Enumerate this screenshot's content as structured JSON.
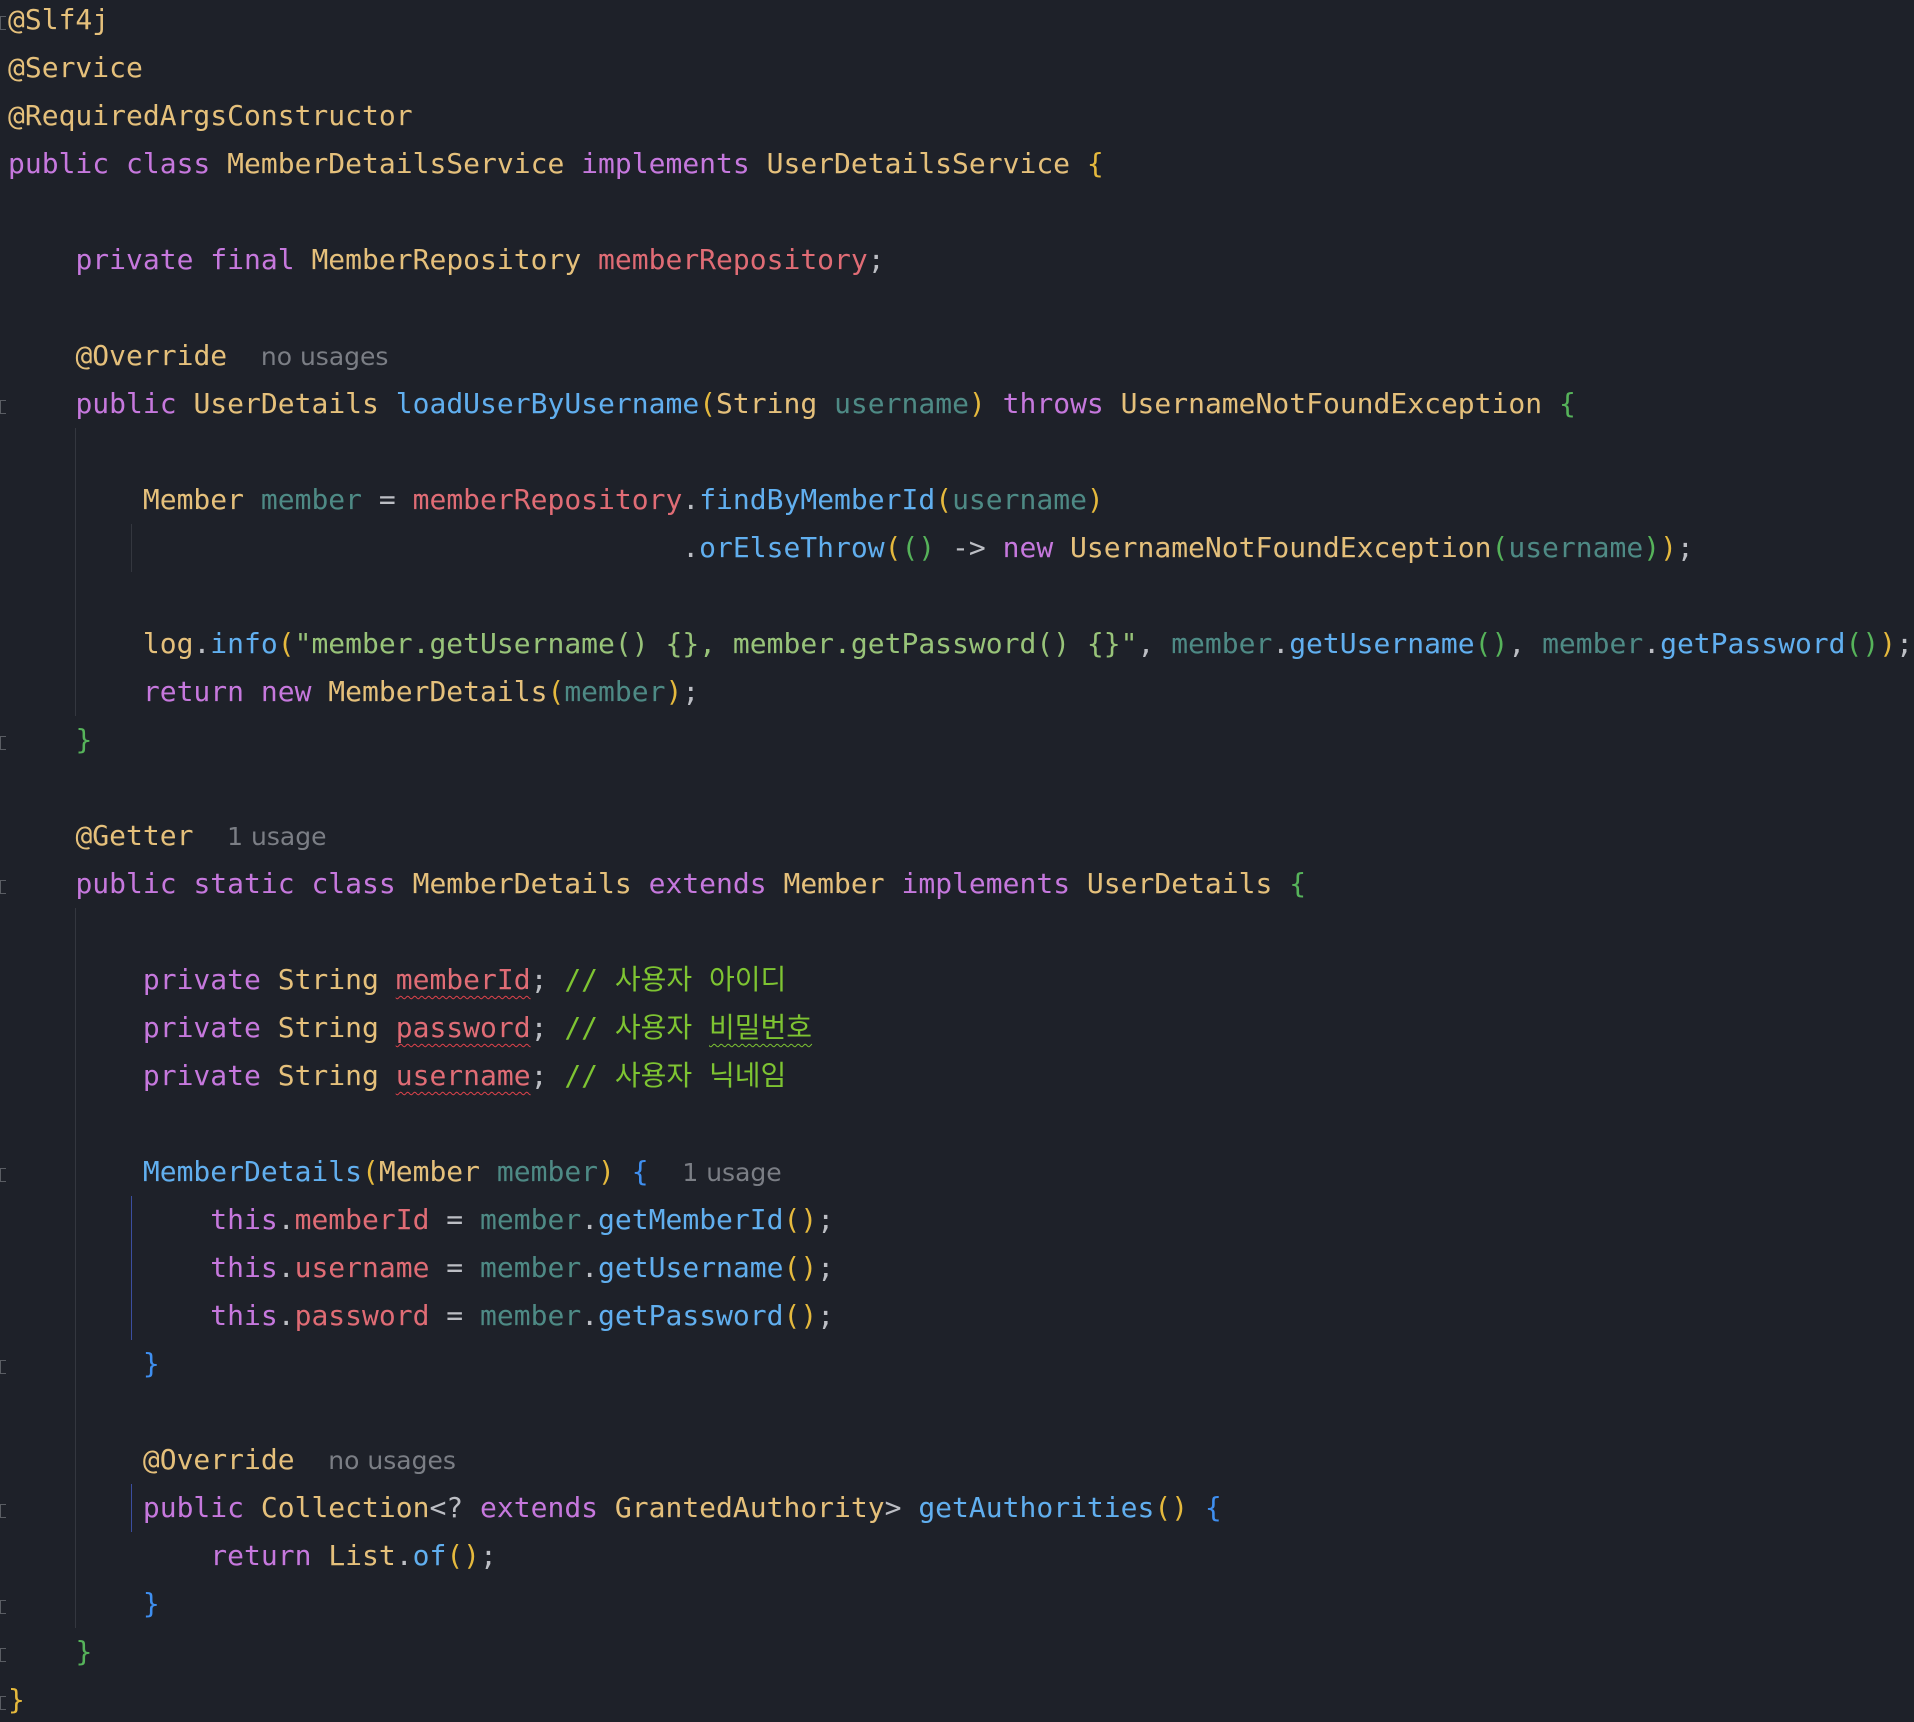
{
  "theme": {
    "background": "#1e2129",
    "keyword": "#c678dd",
    "type": "#e5c07b",
    "method": "#61afef",
    "field": "#e06c75",
    "param": "#4e8a85",
    "string": "#98c379",
    "comment": "#7ec432",
    "brace1": "#e5b93d",
    "brace2": "#56b35a",
    "brace3": "#3f8ff0",
    "plain": "#bcbec4",
    "hint": "#7b7e85",
    "guide": "#34373f",
    "guide_active": "#3b4ea0"
  },
  "lines": [
    [
      {
        "t": "@Slf4j",
        "c": "type"
      }
    ],
    [
      {
        "t": "@Service",
        "c": "type"
      }
    ],
    [
      {
        "t": "@RequiredArgsConstructor",
        "c": "type"
      }
    ],
    [
      {
        "t": "public class ",
        "c": "keyword"
      },
      {
        "t": "MemberDetailsService ",
        "c": "type"
      },
      {
        "t": "implements ",
        "c": "keyword"
      },
      {
        "t": "UserDetailsService ",
        "c": "type"
      },
      {
        "t": "{",
        "c": "brace1"
      }
    ],
    [],
    [
      {
        "t": "    "
      },
      {
        "t": "private final ",
        "c": "keyword"
      },
      {
        "t": "MemberRepository ",
        "c": "type"
      },
      {
        "t": "memberRepository",
        "c": "field"
      },
      {
        "t": ";",
        "c": "plain"
      }
    ],
    [],
    [
      {
        "t": "    "
      },
      {
        "t": "@Override",
        "c": "type"
      },
      {
        "t": "  "
      },
      {
        "t": "no usages",
        "c": "hint",
        "h": 1
      }
    ],
    [
      {
        "t": "    "
      },
      {
        "t": "public ",
        "c": "keyword"
      },
      {
        "t": "UserDetails ",
        "c": "type"
      },
      {
        "t": "loadUserByUsername",
        "c": "method"
      },
      {
        "t": "(",
        "c": "brace1"
      },
      {
        "t": "String ",
        "c": "type"
      },
      {
        "t": "username",
        "c": "param"
      },
      {
        "t": ") ",
        "c": "brace1"
      },
      {
        "t": "throws ",
        "c": "keyword"
      },
      {
        "t": "UsernameNotFoundException ",
        "c": "type"
      },
      {
        "t": "{",
        "c": "brace2"
      }
    ],
    [],
    [
      {
        "t": "        "
      },
      {
        "t": "Member ",
        "c": "type"
      },
      {
        "t": "member",
        "c": "param"
      },
      {
        "t": " = ",
        "c": "plain"
      },
      {
        "t": "memberRepository",
        "c": "field"
      },
      {
        "t": ".",
        "c": "plain"
      },
      {
        "t": "findByMemberId",
        "c": "method"
      },
      {
        "t": "(",
        "c": "brace1"
      },
      {
        "t": "username",
        "c": "param"
      },
      {
        "t": ")",
        "c": "brace1"
      }
    ],
    [
      {
        "t": "                                        "
      },
      {
        "t": ".",
        "c": "plain"
      },
      {
        "t": "orElseThrow",
        "c": "method"
      },
      {
        "t": "(",
        "c": "brace1"
      },
      {
        "t": "()",
        "c": "brace2"
      },
      {
        "t": " -> ",
        "c": "plain"
      },
      {
        "t": "new ",
        "c": "keyword"
      },
      {
        "t": "UsernameNotFoundException",
        "c": "type"
      },
      {
        "t": "(",
        "c": "brace2"
      },
      {
        "t": "username",
        "c": "param"
      },
      {
        "t": ")",
        "c": "brace2"
      },
      {
        "t": ")",
        "c": "brace1"
      },
      {
        "t": ";",
        "c": "plain"
      }
    ],
    [],
    [
      {
        "t": "        "
      },
      {
        "t": "log",
        "c": "type"
      },
      {
        "t": ".",
        "c": "plain"
      },
      {
        "t": "info",
        "c": "method"
      },
      {
        "t": "(",
        "c": "brace1"
      },
      {
        "t": "\"member.getUsername() {}, member.getPassword() {}\"",
        "c": "string"
      },
      {
        "t": ", ",
        "c": "plain"
      },
      {
        "t": "member",
        "c": "param"
      },
      {
        "t": ".",
        "c": "plain"
      },
      {
        "t": "getUsername",
        "c": "method"
      },
      {
        "t": "()",
        "c": "brace2"
      },
      {
        "t": ", ",
        "c": "plain"
      },
      {
        "t": "member",
        "c": "param"
      },
      {
        "t": ".",
        "c": "plain"
      },
      {
        "t": "getPassword",
        "c": "method"
      },
      {
        "t": "()",
        "c": "brace2"
      },
      {
        "t": ")",
        "c": "brace1"
      },
      {
        "t": ";",
        "c": "plain"
      }
    ],
    [
      {
        "t": "        "
      },
      {
        "t": "return new ",
        "c": "keyword"
      },
      {
        "t": "MemberDetails",
        "c": "type"
      },
      {
        "t": "(",
        "c": "brace1"
      },
      {
        "t": "member",
        "c": "param"
      },
      {
        "t": ")",
        "c": "brace1"
      },
      {
        "t": ";",
        "c": "plain"
      }
    ],
    [
      {
        "t": "    "
      },
      {
        "t": "}",
        "c": "brace2"
      }
    ],
    [],
    [
      {
        "t": "    "
      },
      {
        "t": "@Getter",
        "c": "type"
      },
      {
        "t": "  "
      },
      {
        "t": "1 usage",
        "c": "hint",
        "h": 1
      }
    ],
    [
      {
        "t": "    "
      },
      {
        "t": "public static class ",
        "c": "keyword"
      },
      {
        "t": "MemberDetails ",
        "c": "type"
      },
      {
        "t": "extends ",
        "c": "keyword"
      },
      {
        "t": "Member ",
        "c": "type"
      },
      {
        "t": "implements ",
        "c": "keyword"
      },
      {
        "t": "UserDetails ",
        "c": "type"
      },
      {
        "t": "{",
        "c": "brace2"
      }
    ],
    [],
    [
      {
        "t": "        "
      },
      {
        "t": "private ",
        "c": "keyword"
      },
      {
        "t": "String ",
        "c": "type"
      },
      {
        "t": "memberId",
        "c": "field",
        "sq": 1
      },
      {
        "t": "; ",
        "c": "plain"
      },
      {
        "t": "// 사용자 아이디",
        "c": "comment"
      }
    ],
    [
      {
        "t": "        "
      },
      {
        "t": "private ",
        "c": "keyword"
      },
      {
        "t": "String ",
        "c": "type"
      },
      {
        "t": "password",
        "c": "field",
        "sq": 1
      },
      {
        "t": "; ",
        "c": "plain"
      },
      {
        "t": "// 사용자 ",
        "c": "comment"
      },
      {
        "t": "비밀번호",
        "c": "comment",
        "sq": 1
      }
    ],
    [
      {
        "t": "        "
      },
      {
        "t": "private ",
        "c": "keyword"
      },
      {
        "t": "String ",
        "c": "type"
      },
      {
        "t": "username",
        "c": "field",
        "sq": 1
      },
      {
        "t": "; ",
        "c": "plain"
      },
      {
        "t": "// 사용자 닉네임",
        "c": "comment"
      }
    ],
    [],
    [
      {
        "t": "        "
      },
      {
        "t": "MemberDetails",
        "c": "method"
      },
      {
        "t": "(",
        "c": "brace1"
      },
      {
        "t": "Member ",
        "c": "type"
      },
      {
        "t": "member",
        "c": "param"
      },
      {
        "t": ") ",
        "c": "brace1"
      },
      {
        "t": "{",
        "c": "brace3"
      },
      {
        "t": "  "
      },
      {
        "t": "1 usage",
        "c": "hint",
        "h": 1
      }
    ],
    [
      {
        "t": "            "
      },
      {
        "t": "this",
        "c": "keyword"
      },
      {
        "t": ".",
        "c": "plain"
      },
      {
        "t": "memberId",
        "c": "field"
      },
      {
        "t": " = ",
        "c": "plain"
      },
      {
        "t": "member",
        "c": "param"
      },
      {
        "t": ".",
        "c": "plain"
      },
      {
        "t": "getMemberId",
        "c": "method"
      },
      {
        "t": "()",
        "c": "brace1"
      },
      {
        "t": ";",
        "c": "plain"
      }
    ],
    [
      {
        "t": "            "
      },
      {
        "t": "this",
        "c": "keyword"
      },
      {
        "t": ".",
        "c": "plain"
      },
      {
        "t": "username",
        "c": "field"
      },
      {
        "t": " = ",
        "c": "plain"
      },
      {
        "t": "member",
        "c": "param"
      },
      {
        "t": ".",
        "c": "plain"
      },
      {
        "t": "getUsername",
        "c": "method"
      },
      {
        "t": "()",
        "c": "brace1"
      },
      {
        "t": ";",
        "c": "plain"
      }
    ],
    [
      {
        "t": "            "
      },
      {
        "t": "this",
        "c": "keyword"
      },
      {
        "t": ".",
        "c": "plain"
      },
      {
        "t": "password",
        "c": "field"
      },
      {
        "t": " = ",
        "c": "plain"
      },
      {
        "t": "member",
        "c": "param"
      },
      {
        "t": ".",
        "c": "plain"
      },
      {
        "t": "getPassword",
        "c": "method"
      },
      {
        "t": "()",
        "c": "brace1"
      },
      {
        "t": ";",
        "c": "plain"
      }
    ],
    [
      {
        "t": "        "
      },
      {
        "t": "}",
        "c": "brace3"
      }
    ],
    [],
    [
      {
        "t": "        "
      },
      {
        "t": "@Override",
        "c": "type"
      },
      {
        "t": "  "
      },
      {
        "t": "no usages",
        "c": "hint",
        "h": 1
      }
    ],
    [
      {
        "t": "        "
      },
      {
        "t": "public ",
        "c": "keyword"
      },
      {
        "t": "Collection",
        "c": "type"
      },
      {
        "t": "<? ",
        "c": "plain"
      },
      {
        "t": "extends ",
        "c": "keyword"
      },
      {
        "t": "GrantedAuthority",
        "c": "type"
      },
      {
        "t": "> ",
        "c": "plain"
      },
      {
        "t": "getAuthorities",
        "c": "method"
      },
      {
        "t": "() ",
        "c": "brace1"
      },
      {
        "t": "{",
        "c": "brace3"
      }
    ],
    [
      {
        "t": "            "
      },
      {
        "t": "return ",
        "c": "keyword"
      },
      {
        "t": "List",
        "c": "type"
      },
      {
        "t": ".",
        "c": "plain"
      },
      {
        "t": "of",
        "c": "method"
      },
      {
        "t": "()",
        "c": "brace1"
      },
      {
        "t": ";",
        "c": "plain"
      }
    ],
    [
      {
        "t": "        "
      },
      {
        "t": "}",
        "c": "brace3"
      }
    ],
    [
      {
        "t": "    "
      },
      {
        "t": "}",
        "c": "brace2"
      }
    ],
    [
      {
        "t": "}",
        "c": "brace1"
      }
    ]
  ]
}
